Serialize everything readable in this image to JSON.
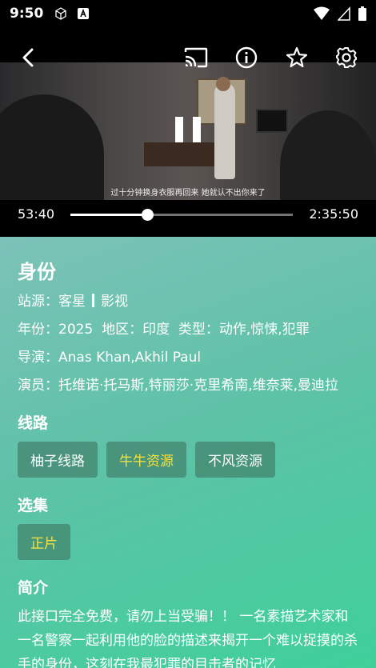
{
  "status_bar": {
    "time": "9:50"
  },
  "video": {
    "subtitle": "过十分钟换身衣服再回来 她就认不出你来了",
    "current_time": "53:40",
    "total_time": "2:35:50",
    "progress": 0.3445
  },
  "details": {
    "title": "身份",
    "source_label": "站源：",
    "source_name": "客星",
    "source_type": "影视",
    "year_label": "年份：",
    "year": "2025",
    "region_label": "地区：",
    "region": "印度",
    "genre_label": "类型：",
    "genre": "动作,惊悚,犯罪",
    "director_label": "导演：",
    "director": "Anas Khan,Akhil Paul",
    "cast_label": "演员：",
    "cast": "托维诺·托马斯,特丽莎·克里希南,维奈莱,曼迪拉",
    "lines_heading": "线路",
    "lines": [
      "柚子线路",
      "牛牛资源",
      "不风资源"
    ],
    "episodes_heading": "选集",
    "episodes": [
      "正片"
    ],
    "intro_heading": "简介",
    "intro_text": "此接口完全免费，请勿上当受骗！！ 一名素描艺术家和一名警察一起利用他的脸的描述来揭开一个难以捉摸的杀手的身份，这刻在我最犯罪的目击者的记忆"
  },
  "colors": {
    "accent_selected": "#f4e341",
    "panel_gradient_start": "#7cc2b8",
    "panel_gradient_end": "#3fd09a"
  }
}
